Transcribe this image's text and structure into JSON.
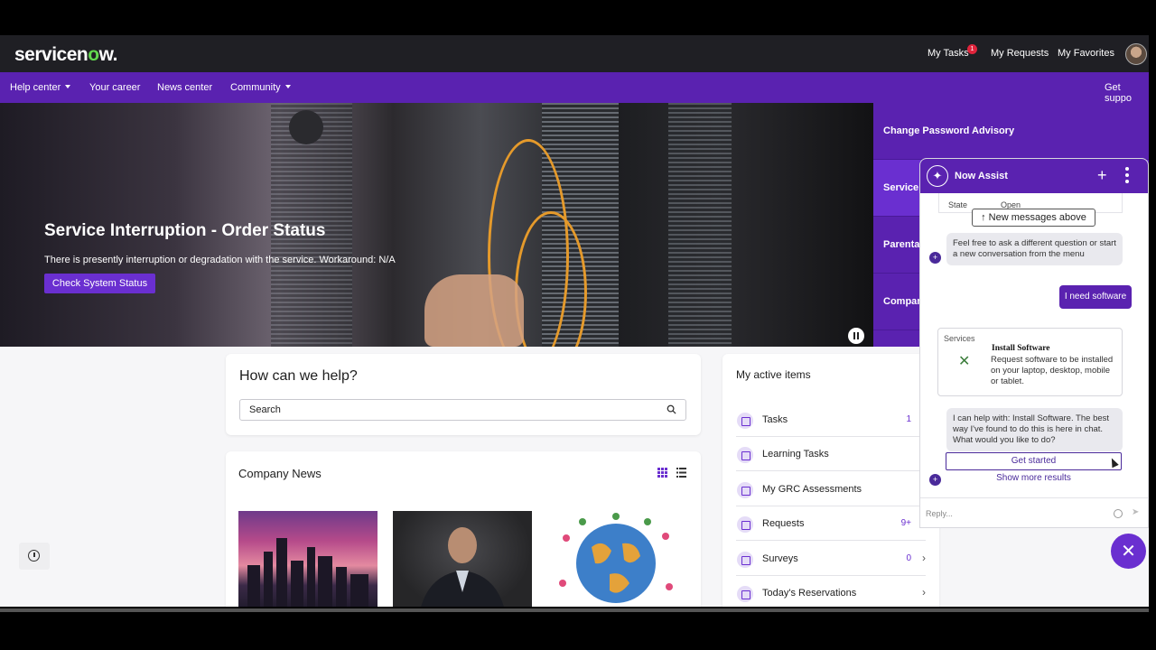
{
  "header": {
    "logo": "servicenow.",
    "my_tasks": "My Tasks",
    "tasks_badge": "1",
    "my_requests": "My Requests",
    "my_favorites": "My Favorites"
  },
  "nav": {
    "help_center": "Help center",
    "your_career": "Your career",
    "news_center": "News center",
    "community": "Community",
    "get_support": "Get suppo"
  },
  "hero": {
    "title": "Service Interruption - Order Status",
    "subtitle": "There is presently interruption or degradation with the service. Workaround: N/A",
    "button": "Check System Status"
  },
  "side_tabs": [
    {
      "label": "Change Password Advisory"
    },
    {
      "label": "Service Int"
    },
    {
      "label": "Parental"
    },
    {
      "label": "Compan"
    }
  ],
  "help": {
    "title": "How can we help?",
    "search_placeholder": "Search"
  },
  "news": {
    "title": "Company News"
  },
  "active": {
    "title": "My active items",
    "rows": [
      {
        "label": "Tasks",
        "count": "1",
        "chevron": ""
      },
      {
        "label": "Learning Tasks",
        "count": "",
        "chevron": ""
      },
      {
        "label": "My GRC Assessments",
        "count": "",
        "chevron": ""
      },
      {
        "label": "Requests",
        "count": "9+",
        "chevron": "›"
      },
      {
        "label": "Surveys",
        "count": "0",
        "chevron": "›"
      },
      {
        "label": "Today's Reservations",
        "count": "",
        "chevron": "›"
      }
    ]
  },
  "assist": {
    "title": "Now Assist",
    "state_key": "State",
    "state_value": "Open",
    "new_messages": "↑ New messages above",
    "bot_msg_1": "Feel free to ask a different question or start a new conversation from the menu",
    "user_msg": "I need software",
    "services_label": "Services",
    "service_title": "Install Software",
    "service_desc": "Request software to be installed on your laptop, desktop, mobile or tablet.",
    "bot_msg_2": "I can help with: Install Software. The best way I've found to do this is here in chat. What would you like to do?",
    "get_started": "Get started",
    "show_more": "Show more results",
    "reply_placeholder": "Reply..."
  },
  "colors": {
    "brand_purple": "#5a22b0",
    "accent_purple": "#6a2fd0",
    "topbar": "#1f1f24",
    "logo_green": "#62d84e"
  }
}
